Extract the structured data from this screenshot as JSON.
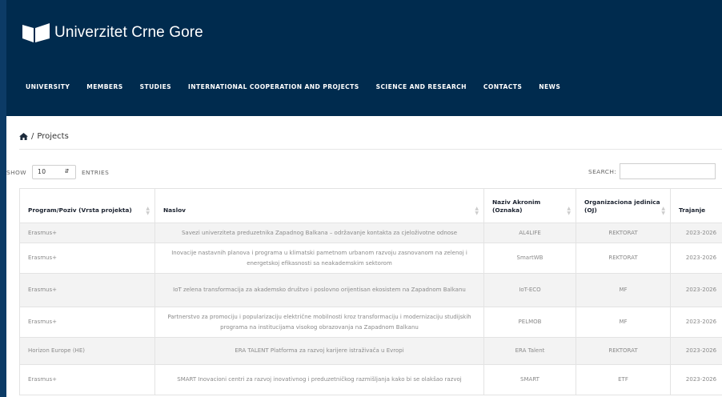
{
  "header": {
    "logo_text": "Univerzitet Crne Gore",
    "nav": [
      "UNIVERSITY",
      "MEMBERS",
      "STUDIES",
      "INTERNATIONAL COOPERATION AND PROJECTS",
      "SCIENCE AND RESEARCH",
      "CONTACTS",
      "NEWS"
    ]
  },
  "breadcrumb": {
    "separator": "/",
    "current": "Projects"
  },
  "controls": {
    "show_label": "SHOW",
    "entries_value": "10",
    "entries_label": "ENTRIES",
    "search_label": "SEARCH:",
    "search_value": ""
  },
  "table": {
    "headers": [
      "Program/Poziv (Vrsta projekta)",
      "Naslov",
      "Naziv Akronim (Oznaka)",
      "Organizaciona jedinica (OJ)",
      "Trajanje"
    ],
    "rows": [
      [
        "Erasmus+",
        "Savezi univerziteta preduzetnika Zapadnog Balkana – održavanje kontakta za cjeloživotne odnose",
        "AL4LIFE",
        "REKTORAT",
        "2023-2026"
      ],
      [
        "Erasmus+",
        "Inovacije nastavnih planova i programa u klimatski pametnom urbanom razvoju zasnovanom na zelenoj i energetskoj efikasnosti sa neakademskim sektorom",
        "SmartWB",
        "REKTORAT",
        "2023-2026"
      ],
      [
        "Erasmus+",
        "IoT zelena transformacija za akademsko društvo i poslovno orijentisan ekosistem na Zapadnom Balkanu",
        "IoT-ECO",
        "MF",
        "2023-2026"
      ],
      [
        "Erasmus+",
        "Partnerstvo za promociju i popularizaciju električne mobilnosti kroz transformaciju i modernizaciju studijskih programa na institucijama visokog obrazovanja na Zapadnom Balkanu",
        "PELMOB",
        "MF",
        "2023-2026"
      ],
      [
        "Horizon Europe (HE)",
        "ERA TALENT Platforma za razvoj karijere istraživača u Evropi",
        "ERA Talent",
        "REKTORAT",
        "2023-2026"
      ],
      [
        "Erasmus+",
        "SMART Inovacioni centri za razvoj inovativnog i preduzetničkog razmišljanja kako bi se olakšao razvoj",
        "SMART",
        "ETF",
        "2023-2026"
      ]
    ]
  }
}
